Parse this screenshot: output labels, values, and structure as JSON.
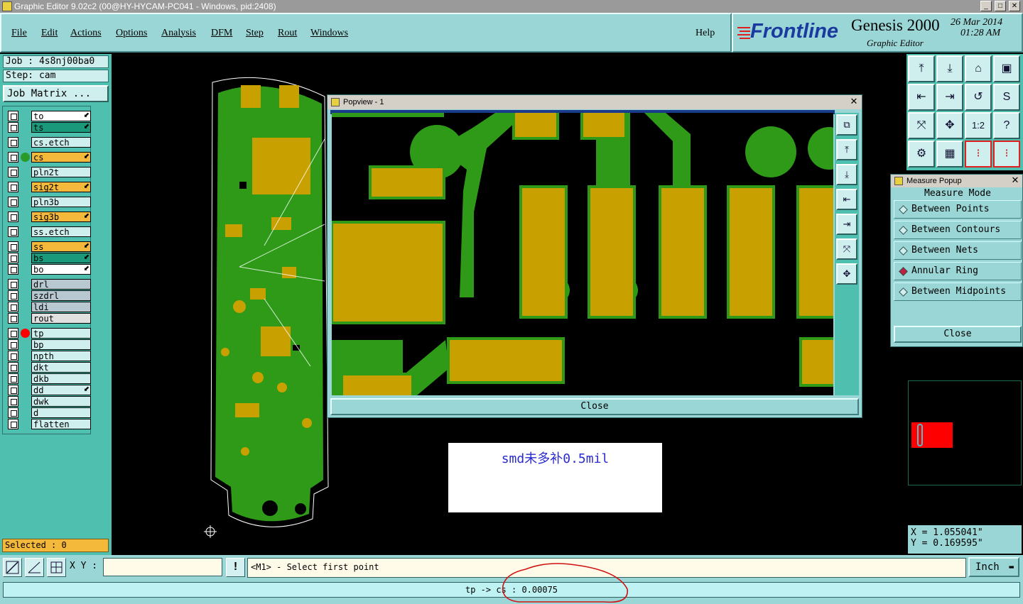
{
  "window": {
    "title": "Graphic Editor 9.02c2 (00@HY-HYCAM-PC041 - Windows, pid:2408)"
  },
  "menu": {
    "items": [
      "File",
      "Edit",
      "Actions",
      "Options",
      "Analysis",
      "DFM",
      "Step",
      "Rout",
      "Windows"
    ],
    "help": "Help"
  },
  "brand": {
    "logo": "Frontline",
    "product": "Genesis 2000",
    "subtitle": "Graphic Editor",
    "date": "26 Mar 2014",
    "time": "01:28 AM"
  },
  "job": {
    "job_label": "Job  : 4s8nj00ba0",
    "step_label": "Step: cam",
    "matrix_button": "Job Matrix ..."
  },
  "layers": [
    {
      "name": "to",
      "color": "#ffffff",
      "arrow": true
    },
    {
      "name": "ts",
      "color": "#1a9a7a",
      "arrow": true
    },
    {
      "name": "cs.etch",
      "color": "#cfeeee",
      "arrow": false
    },
    {
      "name": "cs",
      "color": "#f4b83a",
      "arrow": true,
      "dot": "#2a9a2a"
    },
    {
      "name": "pln2t",
      "color": "#cfeeee",
      "arrow": false
    },
    {
      "name": "sig2t",
      "color": "#f4b83a",
      "arrow": true
    },
    {
      "name": "pln3b",
      "color": "#cfeeee",
      "arrow": false
    },
    {
      "name": "sig3b",
      "color": "#f4b83a",
      "arrow": true
    },
    {
      "name": "ss.etch",
      "color": "#cfeeee",
      "arrow": false
    },
    {
      "name": "ss",
      "color": "#f4b83a",
      "arrow": true
    },
    {
      "name": "bs",
      "color": "#1a9a7a",
      "arrow": true
    },
    {
      "name": "bo",
      "color": "#ffffff",
      "arrow": true
    },
    {
      "name": "drl",
      "color": "#b8c8d0",
      "arrow": false
    },
    {
      "name": "szdrl",
      "color": "#b8c8d0",
      "arrow": false
    },
    {
      "name": "ldi",
      "color": "#b8c8d0",
      "arrow": false
    },
    {
      "name": "rout",
      "color": "#e0e0e0",
      "arrow": false
    },
    {
      "name": "tp",
      "color": "#cfeeee",
      "arrow": false,
      "dot": "#ff0000"
    },
    {
      "name": "bp",
      "color": "#cfeeee",
      "arrow": false
    },
    {
      "name": "npth",
      "color": "#cfeeee",
      "arrow": false
    },
    {
      "name": "dkt",
      "color": "#cfeeee",
      "arrow": false
    },
    {
      "name": "dkb",
      "color": "#cfeeee",
      "arrow": false
    },
    {
      "name": "dd",
      "color": "#cfeeee",
      "arrow": true
    },
    {
      "name": "dwk",
      "color": "#cfeeee",
      "arrow": false
    },
    {
      "name": "d",
      "color": "#cfeeee",
      "arrow": false
    },
    {
      "name": "flatten",
      "color": "#cfeeee",
      "arrow": false
    }
  ],
  "selected": "Selected : 0",
  "popview": {
    "title": "Popview - 1",
    "close": "Close"
  },
  "measure": {
    "title": "Measure Popup",
    "header": "Measure Mode",
    "options": [
      "Between Points",
      "Between Contours",
      "Between Nets",
      "Annular Ring",
      "Between Midpoints"
    ],
    "selected_index": 3,
    "close": "Close"
  },
  "annotation": {
    "text": "smd未多补0.5mil"
  },
  "coords": {
    "x": "X = 1.055041\"",
    "y": "Y = 0.169595\""
  },
  "bottom": {
    "xy_label": "X Y :",
    "xy_value": "",
    "prompt": "<M1> - Select first point",
    "units": "Inch"
  },
  "status": "tp -> cs : 0.00075",
  "colors": {
    "panel": "#9bd6d6",
    "copper": "#c8a000",
    "trace": "#2e9a18",
    "accent": "#f4b83a"
  }
}
